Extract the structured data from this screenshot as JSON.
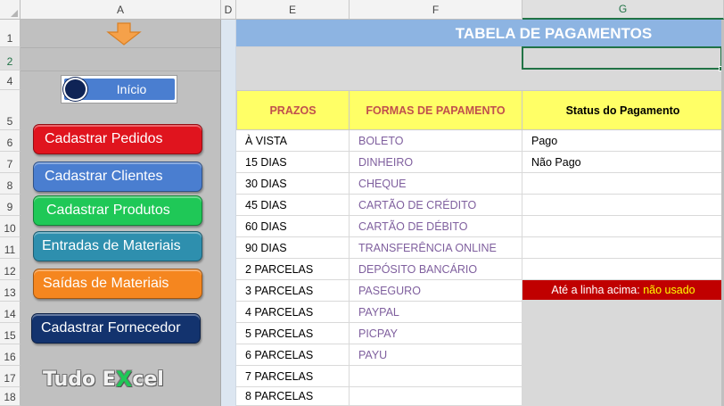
{
  "columns": [
    "A",
    "D",
    "E",
    "F",
    "G"
  ],
  "rows": [
    "1",
    "2",
    "4",
    "5",
    "6",
    "7",
    "8",
    "9",
    "10",
    "11",
    "12",
    "13",
    "14",
    "15",
    "16",
    "17",
    "18"
  ],
  "panel": {
    "toggle_label": "Início",
    "buttons": [
      "Cadastrar Pedidos",
      "Cadastrar Clientes",
      "Cadastrar Produtos",
      "Entradas de Materiais",
      "Saídas de Materiais",
      "Cadastrar Fornecedor"
    ],
    "logo": {
      "part1": "Tudo E",
      "part2": "X",
      "part3": "cel"
    }
  },
  "table": {
    "title": "TABELA DE PAGAMENTOS",
    "headers": [
      "PRAZOS",
      "FORMAS DE PAPAMENTO",
      "Status do Pagamento"
    ],
    "prazos": [
      "À VISTA",
      "15 DIAS",
      "30 DIAS",
      "45 DIAS",
      "60 DIAS",
      "90 DIAS",
      "2 PARCELAS",
      "3 PARCELAS",
      "4 PARCELAS",
      "5 PARCELAS",
      "6 PARCELAS",
      "7 PARCELAS",
      "8 PARCELAS"
    ],
    "formas": [
      "BOLETO",
      "DINHEIRO",
      "CHEQUE",
      "CARTÃO DE CRÉDITO",
      "CARTÃO DE DÉBITO",
      "TRANSFERÊNCIA ONLINE",
      "DEPÓSITO BANCÁRIO",
      "PASEGURO",
      "PAYPAL",
      "PICPAY",
      "PAYU",
      "",
      ""
    ],
    "status": [
      "Pago",
      "Não Pago"
    ],
    "note_prefix": "Até a linha acima:",
    "note_highlight": "não usado"
  },
  "colors": {
    "title_bar": "#8db4e2",
    "header_fill": "#ffff66",
    "header_text_red": "#c0504d",
    "note_fill": "#c00000",
    "note_highlight": "#ffff00",
    "forms_text": "#7f5f9e",
    "btn_red": "#e0141e",
    "btn_blue": "#4a7ed0",
    "btn_green": "#1fc857",
    "btn_teal": "#2e8fae",
    "btn_orange": "#f5861f",
    "btn_navy": "#13336e"
  }
}
